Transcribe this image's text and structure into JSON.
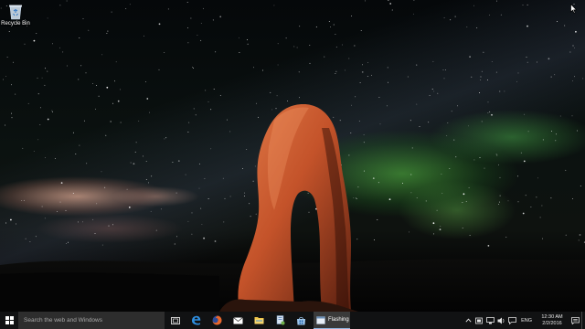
{
  "desktop": {
    "icons": [
      {
        "label": "Recycle Bin",
        "icon": "recycle-bin-icon"
      }
    ]
  },
  "taskbar": {
    "search": {
      "placeholder": "Search the web and Windows"
    },
    "pinned": [
      {
        "name": "task-view",
        "icon": "task-view-icon"
      },
      {
        "name": "edge",
        "icon": "edge-icon"
      },
      {
        "name": "firefox",
        "icon": "firefox-icon"
      },
      {
        "name": "mail",
        "icon": "mail-icon"
      },
      {
        "name": "file-explorer",
        "icon": "folder-icon"
      },
      {
        "name": "app-5",
        "icon": "document-app-icon"
      },
      {
        "name": "app-6",
        "icon": "store-icon"
      }
    ],
    "running_app": {
      "label": "Flashing",
      "icon": "window-app-icon"
    },
    "tray": {
      "language": "ENG",
      "time": "12:30 AM",
      "date": "2/2/2016"
    }
  },
  "colors": {
    "taskbar_bg": "#111213",
    "search_bg": "#2d2d2d",
    "accent": "#8fb4de"
  }
}
